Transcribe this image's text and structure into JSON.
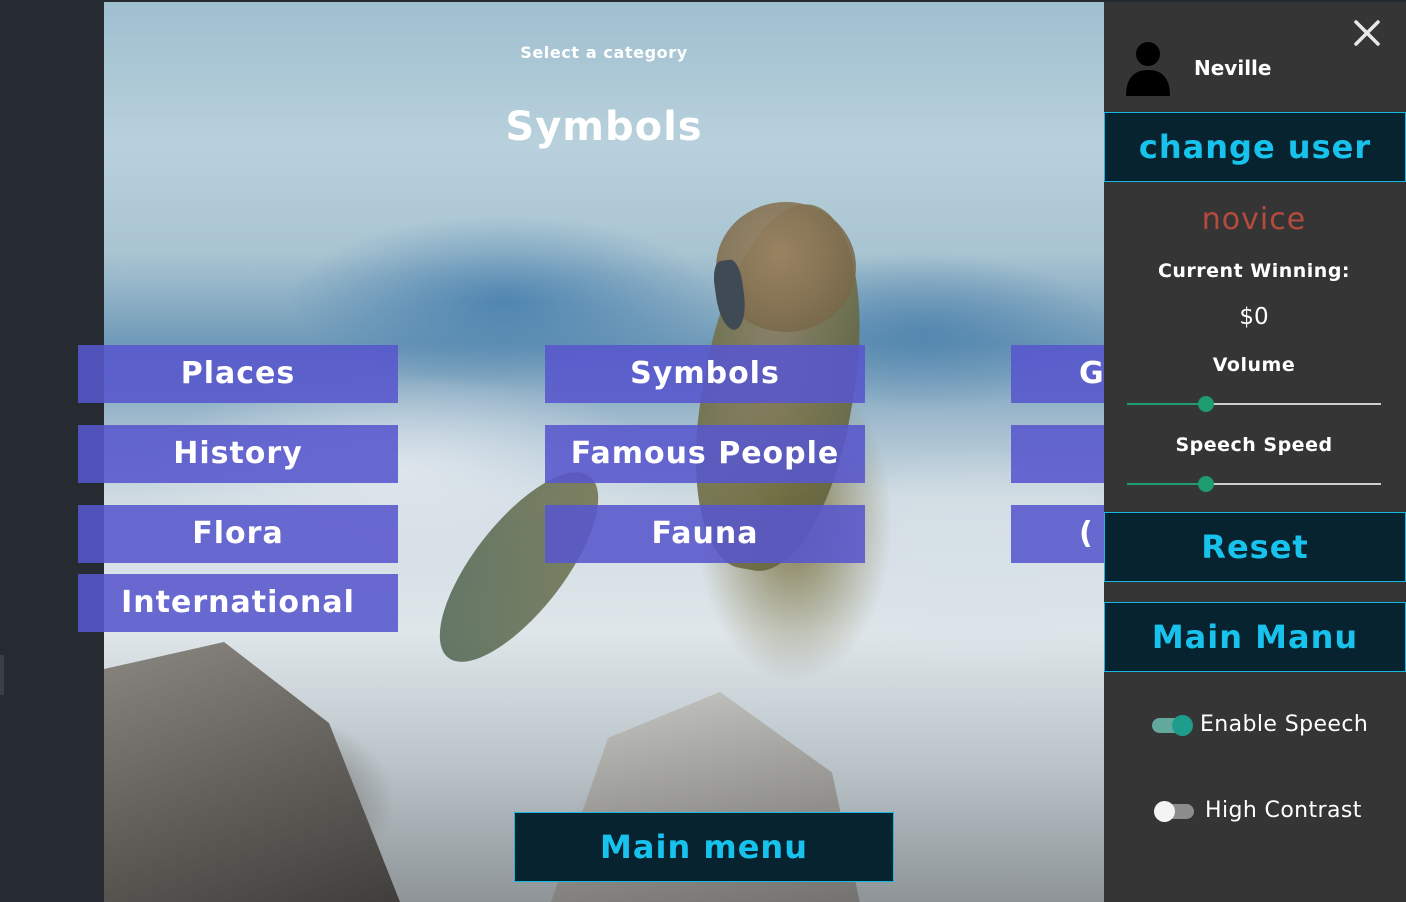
{
  "header": {
    "subtitle": "Select a category",
    "title": "Symbols"
  },
  "categories": [
    {
      "label": "Places"
    },
    {
      "label": "Symbols"
    },
    {
      "label": "G"
    },
    {
      "label": "History"
    },
    {
      "label": "Famous People"
    },
    {
      "label": ""
    },
    {
      "label": "Flora"
    },
    {
      "label": "Fauna"
    },
    {
      "label": "("
    },
    {
      "label": "International"
    }
  ],
  "main_menu_button": "Main menu",
  "sidebar": {
    "close_icon": "close-icon",
    "avatar_icon": "user-icon",
    "username": "Neville",
    "change_user_label": "change user",
    "level": "novice",
    "current_winning_label": "Current Winning:",
    "current_winning_value": "$0",
    "volume_label": "Volume",
    "volume_level": 0.31,
    "speech_speed_label": "Speech Speed",
    "speech_speed_level": 0.31,
    "reset_label": "Reset",
    "main_manu_label": "Main Manu",
    "enable_speech_label": "Enable Speech",
    "enable_speech_on": true,
    "high_contrast_label": "High Contrast",
    "high_contrast_on": false
  },
  "colors": {
    "category_button": "#5856cd",
    "accent_cyan": "#17c3ec",
    "button_dark": "#07232f",
    "sidebar_bg": "#353535",
    "level_text": "#b54b3c",
    "slider_green": "#1f9d70"
  }
}
